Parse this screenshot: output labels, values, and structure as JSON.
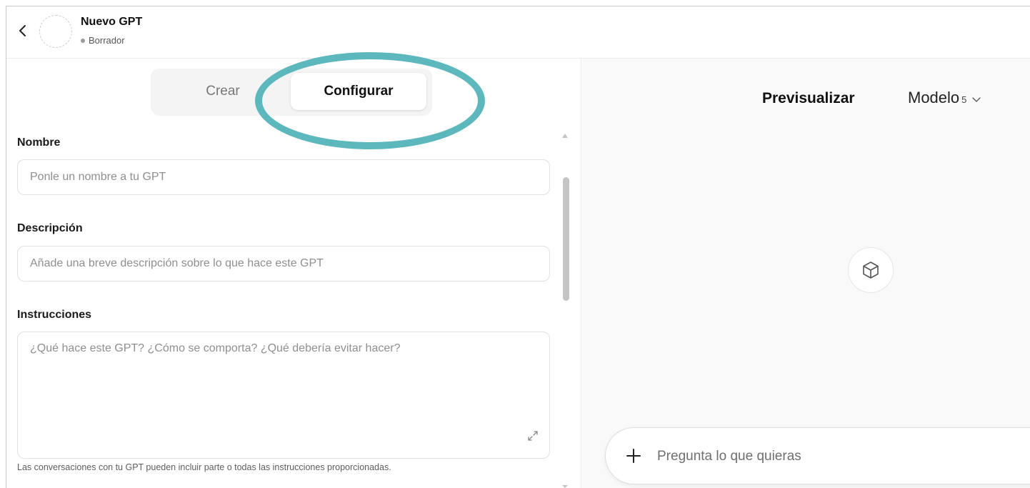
{
  "header": {
    "title": "Nuevo GPT",
    "status": "Borrador"
  },
  "tabs": [
    {
      "label": "Crear",
      "selected": false
    },
    {
      "label": "Configurar",
      "selected": true
    }
  ],
  "form": {
    "name": {
      "label": "Nombre",
      "placeholder": "Ponle un nombre a tu GPT",
      "value": ""
    },
    "description": {
      "label": "Descripción",
      "placeholder": "Añade una breve descripción sobre lo que hace este GPT",
      "value": ""
    },
    "instructions": {
      "label": "Instrucciones",
      "placeholder": "¿Qué hace este GPT? ¿Cómo se comporta? ¿Qué debería evitar hacer?",
      "value": ""
    },
    "helper": "Las conversaciones con tu GPT pueden incluir parte o todas las instrucciones proporcionadas."
  },
  "preview": {
    "title": "Previsualizar",
    "model_label": "Modelo",
    "model_version": "5",
    "composer_placeholder": "Pregunta lo que quieras"
  },
  "colors": {
    "highlight_ring": "#5db8be",
    "preview_background": "#f9f9f9"
  },
  "icons": [
    "chevron-left-icon",
    "chevron-down-icon",
    "cube-icon",
    "plus-icon",
    "expand-icon"
  ]
}
